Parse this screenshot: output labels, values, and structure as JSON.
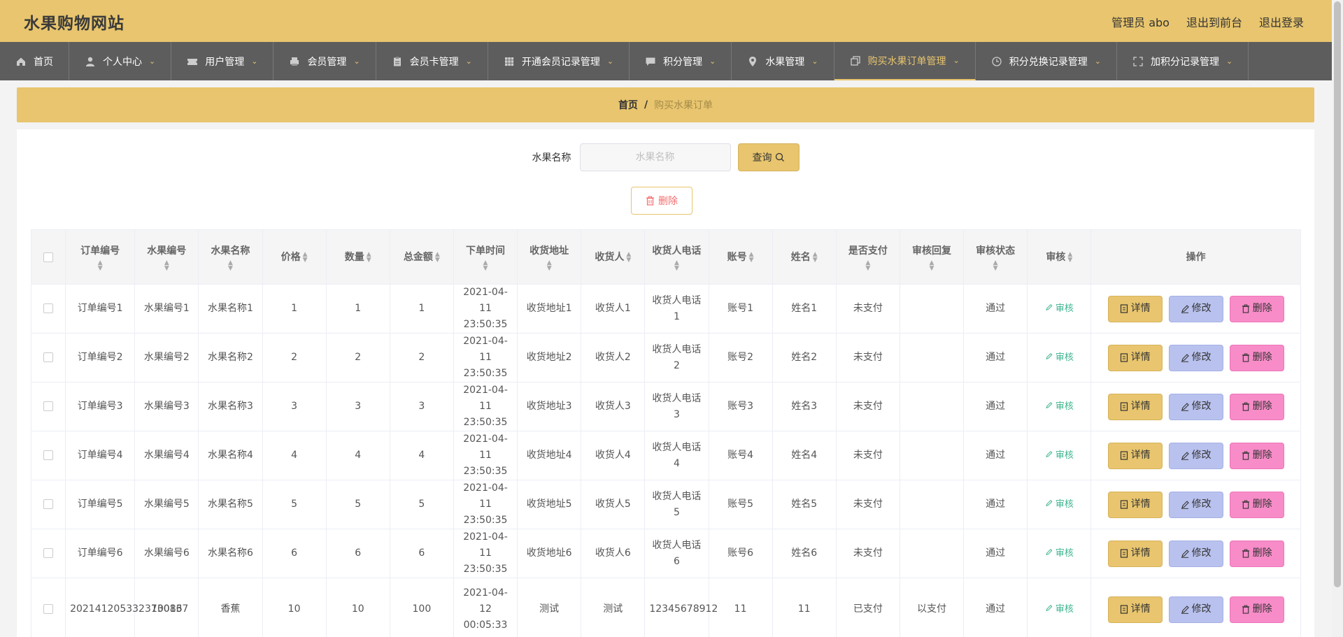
{
  "header": {
    "title": "水果购物网站",
    "admin": "管理员 abo",
    "exit_front": "退出到前台",
    "logout": "退出登录"
  },
  "nav": [
    {
      "label": "首页",
      "icon": "home-icon",
      "chevron": false
    },
    {
      "label": "个人中心",
      "icon": "user-icon",
      "chevron": true
    },
    {
      "label": "用户管理",
      "icon": "ticket-icon",
      "chevron": true
    },
    {
      "label": "会员管理",
      "icon": "printer-icon",
      "chevron": true
    },
    {
      "label": "会员卡管理",
      "icon": "clipboard-icon",
      "chevron": true
    },
    {
      "label": "开通会员记录管理",
      "icon": "grid-icon",
      "chevron": true
    },
    {
      "label": "积分管理",
      "icon": "chat-icon",
      "chevron": true
    },
    {
      "label": "水果管理",
      "icon": "location-icon",
      "chevron": true
    },
    {
      "label": "购买水果订单管理",
      "icon": "copy-icon",
      "chevron": true,
      "active": true
    },
    {
      "label": "积分兑换记录管理",
      "icon": "clock-icon",
      "chevron": true
    },
    {
      "label": "加积分记录管理",
      "icon": "fullscreen-icon",
      "chevron": true
    }
  ],
  "breadcrumb": {
    "home": "首页",
    "sep": "/",
    "current": "购买水果订单"
  },
  "search": {
    "label": "水果名称",
    "placeholder": "水果名称",
    "button": "查询"
  },
  "delete_button": "删除",
  "table": {
    "columns": [
      "订单编号",
      "水果编号",
      "水果名称",
      "价格",
      "数量",
      "总金额",
      "下单时间",
      "收货地址",
      "收货人",
      "收货人电话",
      "账号",
      "姓名",
      "是否支付",
      "审核回复",
      "审核状态",
      "审核",
      "操作"
    ],
    "rows": [
      [
        "订单编号1",
        "水果编号1",
        "水果名称1",
        "1",
        "1",
        "1",
        "2021-04-11 23:50:35",
        "收货地址1",
        "收货人1",
        "收货人电话1",
        "账号1",
        "姓名1",
        "未支付",
        "",
        "通过"
      ],
      [
        "订单编号2",
        "水果编号2",
        "水果名称2",
        "2",
        "2",
        "2",
        "2021-04-11 23:50:35",
        "收货地址2",
        "收货人2",
        "收货人电话2",
        "账号2",
        "姓名2",
        "未支付",
        "",
        "通过"
      ],
      [
        "订单编号3",
        "水果编号3",
        "水果名称3",
        "3",
        "3",
        "3",
        "2021-04-11 23:50:35",
        "收货地址3",
        "收货人3",
        "收货人电话3",
        "账号3",
        "姓名3",
        "未支付",
        "",
        "通过"
      ],
      [
        "订单编号4",
        "水果编号4",
        "水果名称4",
        "4",
        "4",
        "4",
        "2021-04-11 23:50:35",
        "收货地址4",
        "收货人4",
        "收货人电话4",
        "账号4",
        "姓名4",
        "未支付",
        "",
        "通过"
      ],
      [
        "订单编号5",
        "水果编号5",
        "水果名称5",
        "5",
        "5",
        "5",
        "2021-04-11 23:50:35",
        "收货地址5",
        "收货人5",
        "收货人电话5",
        "账号5",
        "姓名5",
        "未支付",
        "",
        "通过"
      ],
      [
        "订单编号6",
        "水果编号6",
        "水果名称6",
        "6",
        "6",
        "6",
        "2021-04-11 23:50:35",
        "收货地址6",
        "收货人6",
        "收货人电话6",
        "账号6",
        "姓名6",
        "未支付",
        "",
        "通过"
      ],
      [
        "2021412053323730137",
        "10086",
        "香蕉",
        "10",
        "10",
        "100",
        "2021-04-12 00:05:33",
        "测试",
        "测试",
        "12345678912",
        "11",
        "11",
        "已支付",
        "以支付",
        "通过"
      ]
    ],
    "audit_label": "审核",
    "op_detail": "详情",
    "op_edit": "修改",
    "op_delete": "删除"
  },
  "colors": {
    "accent": "#e8c56e",
    "nav_bg": "#5d5d5d",
    "edit": "#b9c2ee",
    "delete": "#f78cc8",
    "audit": "#3eb38f"
  }
}
